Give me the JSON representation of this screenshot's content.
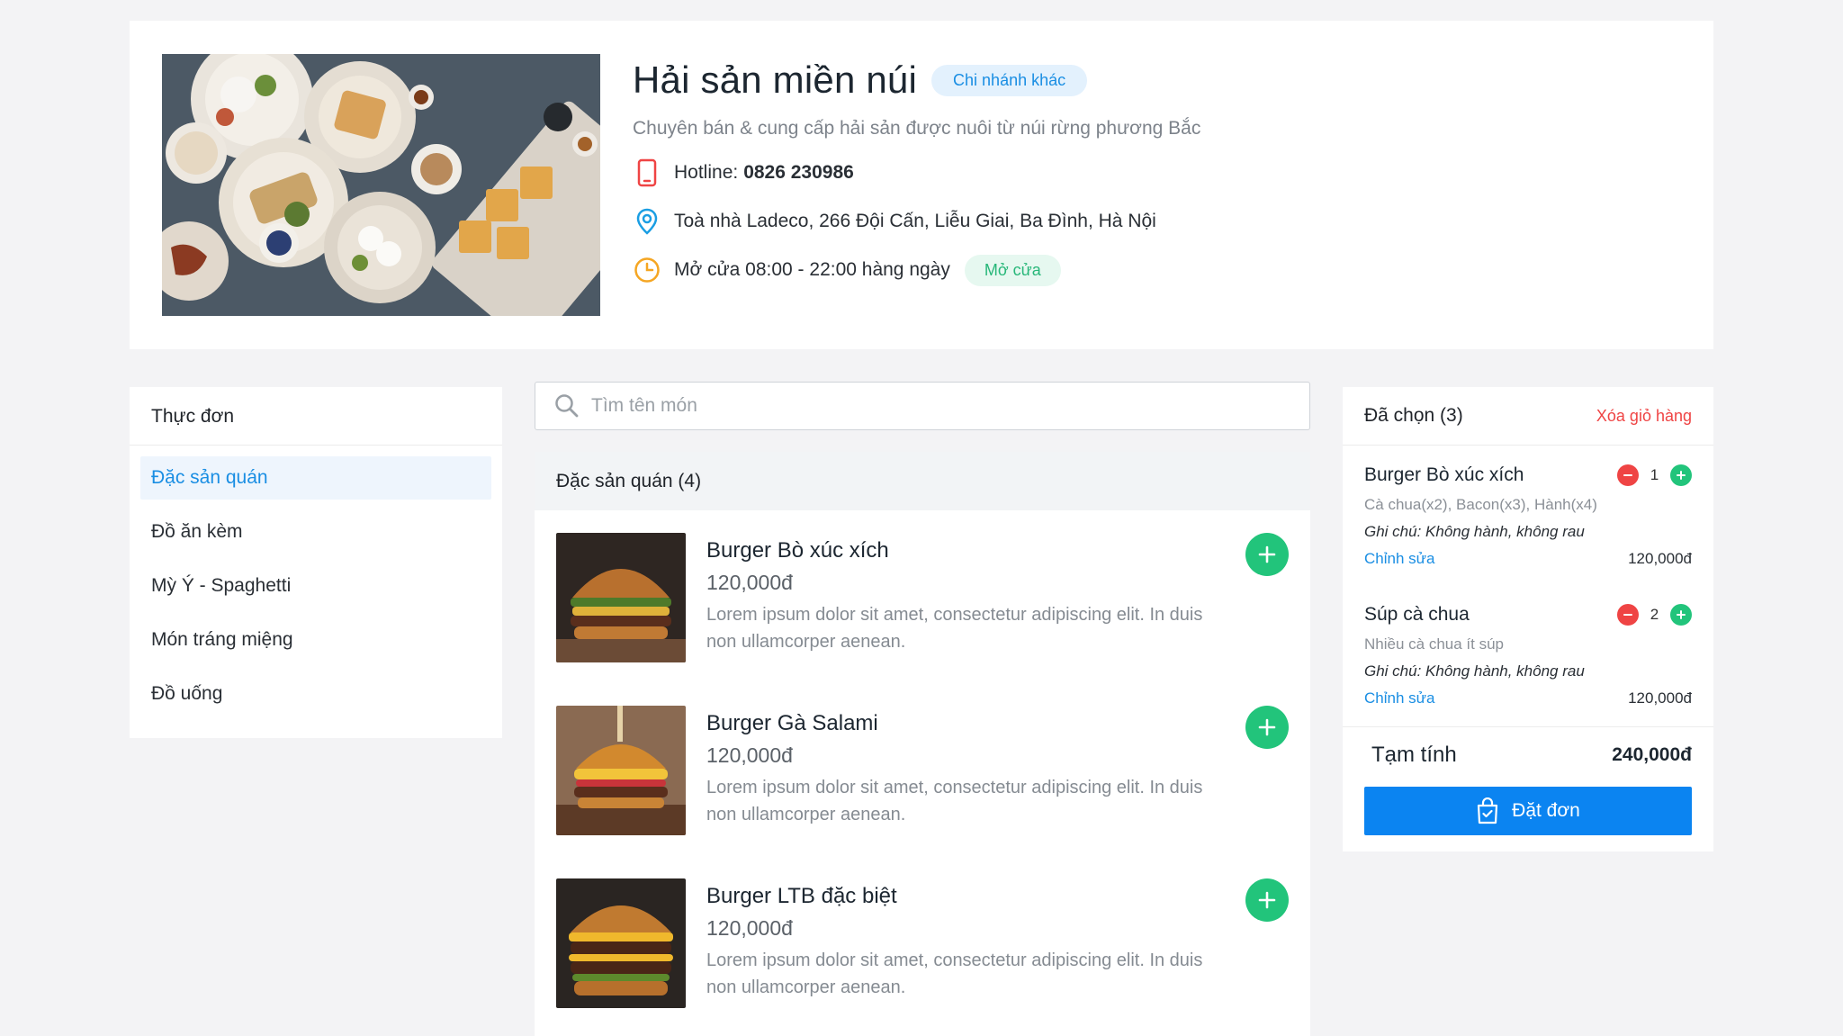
{
  "restaurant": {
    "name": "Hải sản miền núi",
    "branch_badge": "Chi nhánh khác",
    "description": "Chuyên bán & cung cấp hải sản được nuôi từ núi rừng phương Bắc",
    "hotline_label": "Hotline:",
    "hotline": "0826 230986",
    "address": "Toà nhà Ladeco, 266 Đội Cấn, Liễu Giai, Ba Đình, Hà Nội",
    "hours": "Mở cửa 08:00 - 22:00 hàng ngày",
    "status": "Mở cửa"
  },
  "menu": {
    "title": "Thực đơn",
    "items": [
      {
        "label": "Đặc sản quán",
        "active": true
      },
      {
        "label": "Đồ ăn kèm"
      },
      {
        "label": "Mỳ Ý - Spaghetti"
      },
      {
        "label": "Món tráng miệng"
      },
      {
        "label": "Đồ uống"
      }
    ]
  },
  "search": {
    "placeholder": "Tìm tên món"
  },
  "category": {
    "title": "Đặc sản quán (4)",
    "dishes": [
      {
        "name": "Burger Bò xúc xích",
        "price": "120,000đ",
        "description": "Lorem ipsum dolor sit amet, consectetur adipiscing elit. In duis non ullamcorper aenean."
      },
      {
        "name": "Burger Gà Salami",
        "price": "120,000đ",
        "description": "Lorem ipsum dolor sit amet, consectetur adipiscing elit. In duis non ullamcorper aenean."
      },
      {
        "name": "Burger LTB đặc biệt",
        "price": "120,000đ",
        "description": "Lorem ipsum dolor sit amet, consectetur adipiscing elit. In duis non ullamcorper aenean."
      }
    ]
  },
  "cart": {
    "title": "Đã chọn (3)",
    "clear_label": "Xóa giỏ hàng",
    "items": [
      {
        "name": "Burger Bò xúc xích",
        "qty": "1",
        "options": "Cà chua(x2), Bacon(x3), Hành(x4)",
        "note": "Ghi chú: Không hành, không rau",
        "edit_label": "Chỉnh sửa",
        "price": "120,000đ"
      },
      {
        "name": "Súp cà chua",
        "qty": "2",
        "options": "Nhiều cà chua ít súp",
        "note": "Ghi chú: Không hành, không rau",
        "edit_label": "Chỉnh sửa",
        "price": "120,000đ"
      }
    ],
    "subtotal_label": "Tạm tính",
    "subtotal_value": "240,000đ",
    "order_label": "Đặt đơn"
  },
  "colors": {
    "primary": "#0b84f1",
    "link": "#1a8ee3",
    "success": "#22c47b",
    "danger": "#ef4444",
    "hotline_icon": "#ef4444",
    "address_icon": "#1a9ee3",
    "clock_icon": "#f5a623"
  },
  "icons": {
    "hotline": "phone-icon",
    "address": "map-pin-icon",
    "hours": "clock-icon",
    "search": "search-icon",
    "add": "plus-icon",
    "order": "shopping-bag-check-icon"
  }
}
